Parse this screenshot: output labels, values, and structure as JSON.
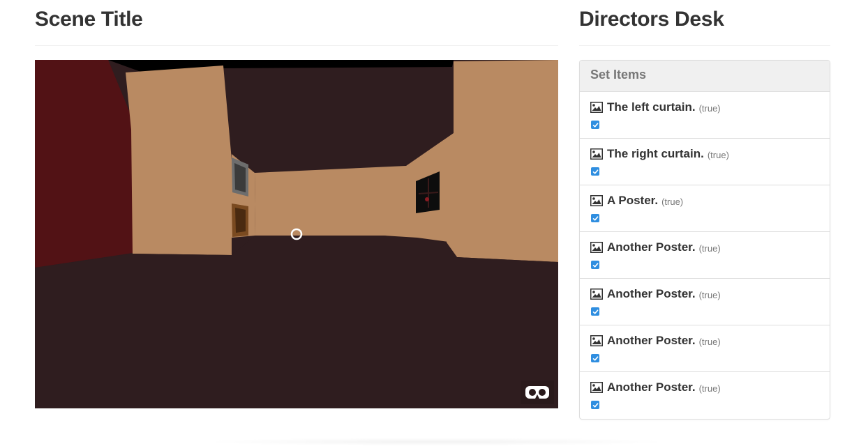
{
  "scene": {
    "title": "Scene Title",
    "vr_button_icon": "vr-goggles-icon",
    "reticle_icon": "gaze-reticle-icon",
    "colors": {
      "floor": "#2f1d1f",
      "ceiling": "#2f1d1f",
      "wall": "#b98a62",
      "curtain_left": "#521215",
      "ceiling_edge": "#000000"
    }
  },
  "directors_desk": {
    "title": "Directors Desk",
    "panel_heading": "Set Items",
    "item_icon": "image-icon",
    "items": [
      {
        "title": "The left curtain.",
        "status": "(true)",
        "checked": true
      },
      {
        "title": "The right curtain.",
        "status": "(true)",
        "checked": true
      },
      {
        "title": "A Poster.",
        "status": "(true)",
        "checked": true
      },
      {
        "title": "Another Poster.",
        "status": "(true)",
        "checked": true
      },
      {
        "title": "Another Poster.",
        "status": "(true)",
        "checked": true
      },
      {
        "title": "Another Poster.",
        "status": "(true)",
        "checked": true
      },
      {
        "title": "Another Poster.",
        "status": "(true)",
        "checked": true
      }
    ],
    "checkbox_color": "#2f8ee0"
  }
}
